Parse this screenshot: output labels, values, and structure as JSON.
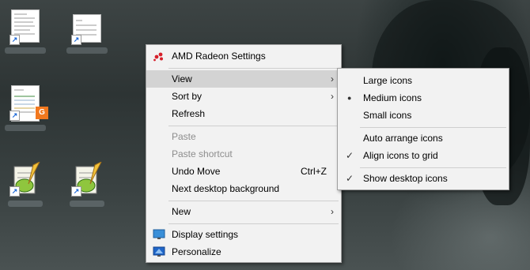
{
  "context_menu": {
    "items": [
      {
        "label": "AMD Radeon Settings",
        "icon": "amd-radeon-icon"
      },
      {
        "label": "View",
        "submenu": true,
        "highlighted": true
      },
      {
        "label": "Sort by",
        "submenu": true
      },
      {
        "label": "Refresh"
      },
      {
        "label": "Paste",
        "disabled": true
      },
      {
        "label": "Paste shortcut",
        "disabled": true
      },
      {
        "label": "Undo Move",
        "shortcut": "Ctrl+Z"
      },
      {
        "label": "Next desktop background"
      },
      {
        "label": "New",
        "submenu": true
      },
      {
        "label": "Display settings",
        "icon": "display-settings-icon"
      },
      {
        "label": "Personalize",
        "icon": "personalize-icon"
      }
    ]
  },
  "view_submenu": {
    "items": [
      {
        "label": "Large icons"
      },
      {
        "label": "Medium icons",
        "selected": true
      },
      {
        "label": "Small icons"
      },
      {
        "label": "Auto arrange icons"
      },
      {
        "label": "Align icons to grid",
        "checked": true
      },
      {
        "label": "Show desktop icons",
        "checked": true
      }
    ]
  },
  "glyphs": {
    "submenu_arrow": "›",
    "bullet": "●",
    "check": "✓",
    "shortcut_arrow": "↗",
    "badge_letter": "G"
  },
  "colors": {
    "menu_bg": "#f2f2f2",
    "highlight": "#d3d3d3",
    "disabled_text": "#8d8d8d",
    "amd_red": "#d61f2a"
  }
}
